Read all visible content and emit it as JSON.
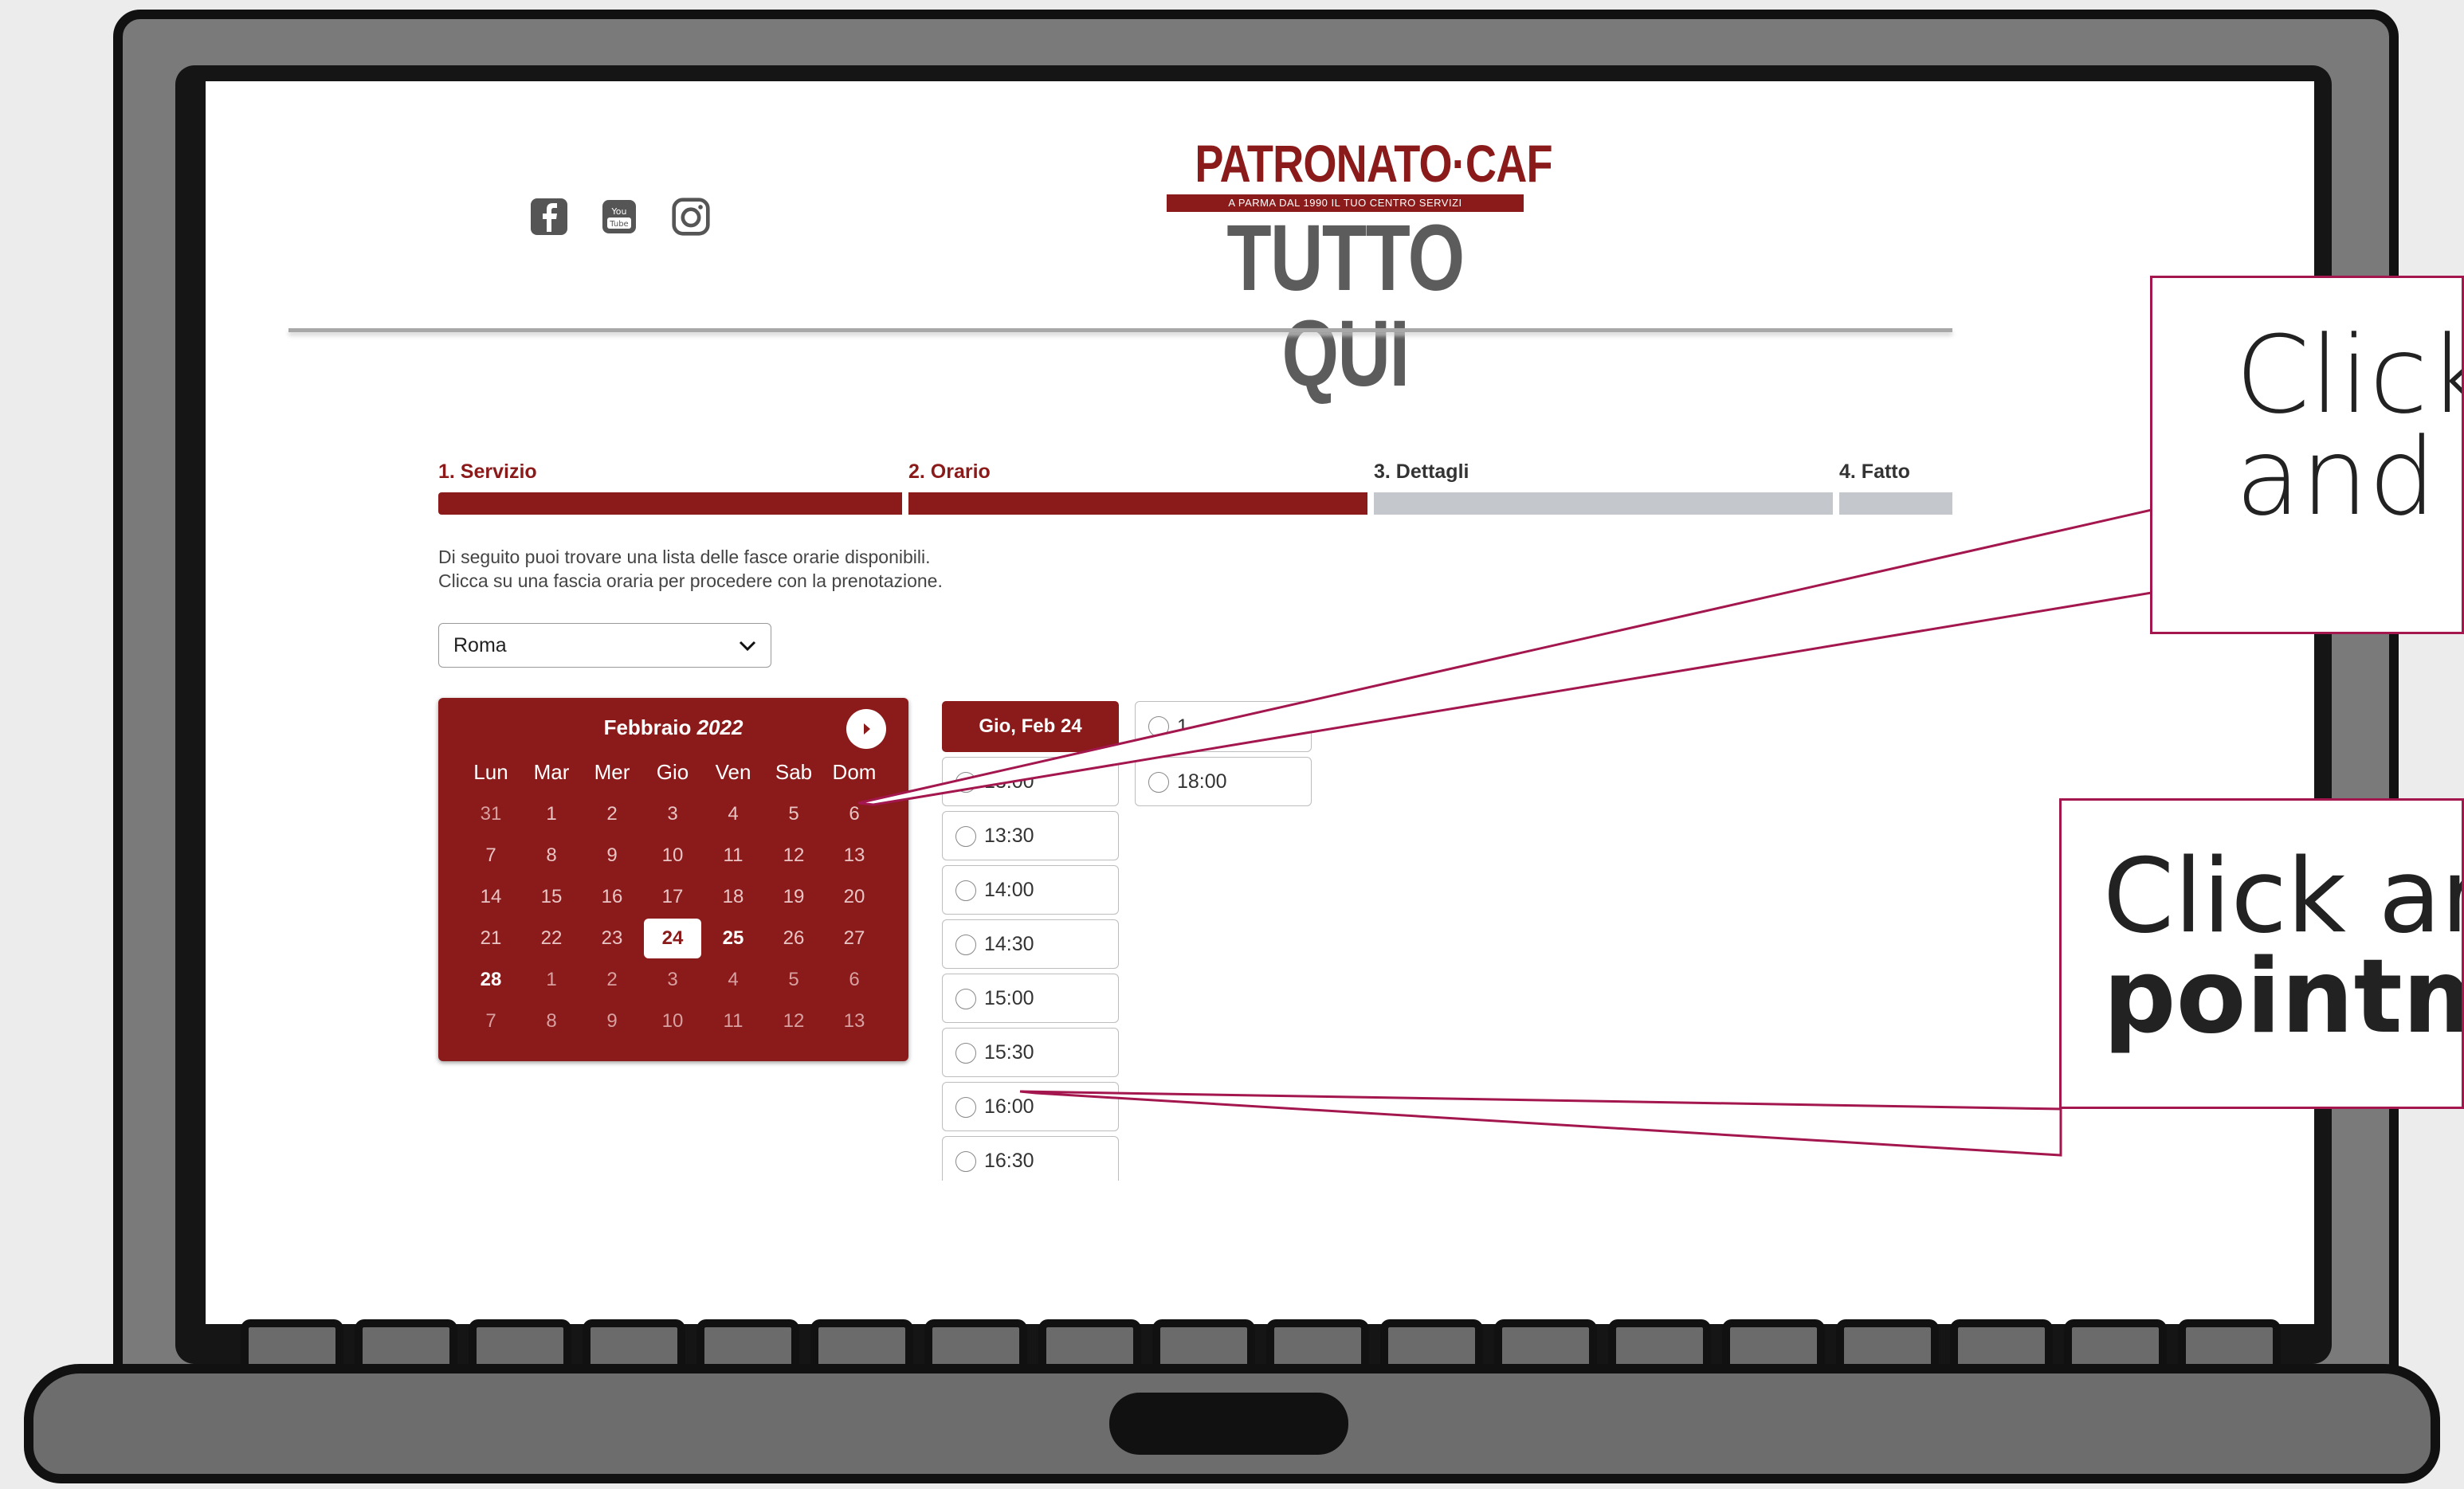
{
  "header": {
    "social_icons": [
      "facebook-icon",
      "youtube-icon",
      "instagram-icon"
    ],
    "logo": {
      "line1": "PATRONATO·CAF",
      "tagline": "A PARMA DAL 1990 IL TUO CENTRO SERVIZI",
      "line2": "TUTTO QUI"
    }
  },
  "steps": [
    {
      "label": "1. Servizio",
      "state": "done"
    },
    {
      "label": "2. Orario",
      "state": "current"
    },
    {
      "label": "3. Dettagli",
      "state": "pending"
    },
    {
      "label": "4. Fatto",
      "state": "pending"
    }
  ],
  "instructions": {
    "line1": "Di seguito puoi trovare una lista delle fasce orarie disponibili.",
    "line2": "Clicca su una fascia oraria per procedere con la prenotazione."
  },
  "city_select": {
    "value": "Roma"
  },
  "calendar": {
    "month": "Febbraio",
    "year": "2022",
    "weekdays": [
      "Lun",
      "Mar",
      "Mer",
      "Gio",
      "Ven",
      "Sab",
      "Dom"
    ],
    "weeks": [
      [
        "31",
        "1",
        "2",
        "3",
        "4",
        "5",
        "6"
      ],
      [
        "7",
        "8",
        "9",
        "10",
        "11",
        "12",
        "13"
      ],
      [
        "14",
        "15",
        "16",
        "17",
        "18",
        "19",
        "20"
      ],
      [
        "21",
        "22",
        "23",
        "24",
        "25",
        "26",
        "27"
      ],
      [
        "28",
        "1",
        "2",
        "3",
        "4",
        "5",
        "6"
      ],
      [
        "7",
        "8",
        "9",
        "10",
        "11",
        "12",
        "13"
      ]
    ],
    "selected_day": "24",
    "available_days": [
      "25",
      "28"
    ]
  },
  "slots": {
    "date_label": "Gio, Feb 24",
    "column1": [
      "13:00",
      "13:30",
      "14:00",
      "14:30",
      "15:00",
      "15:30",
      "16:00",
      "16:30"
    ],
    "column2_top_partial": "1",
    "column2": [
      "18:00"
    ]
  },
  "callouts": {
    "top": {
      "line1": "Click",
      "line2": "and"
    },
    "bottom": {
      "line1": "Click ar",
      "line2": "pointm"
    }
  },
  "colors": {
    "brand": "#8b1a1a",
    "callout_border": "#a3164e",
    "pending_bar": "#c4c7cb"
  }
}
